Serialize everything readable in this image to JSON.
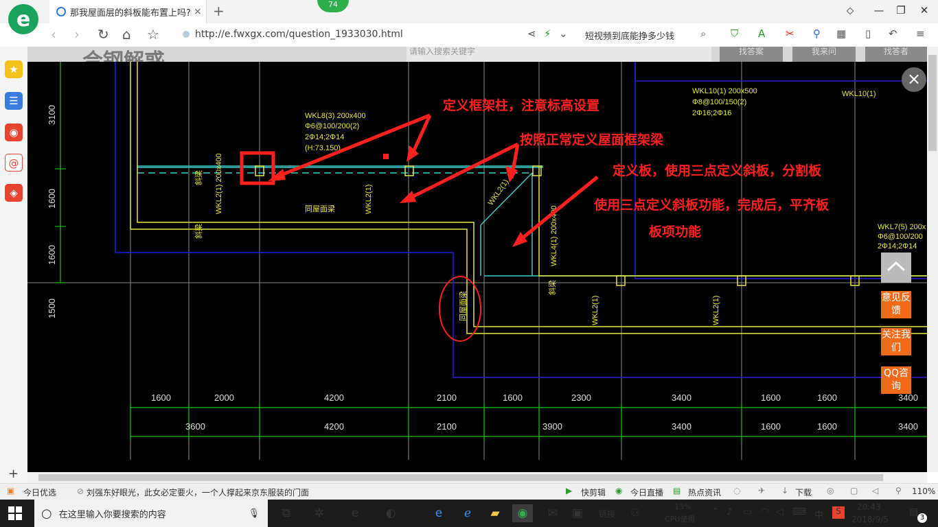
{
  "browser": {
    "tab_title": "那我屋面层的斜板能布置上吗? 7",
    "tab_close": "×",
    "new_tab": "+",
    "notif_badge": "74",
    "url": "http://e.fwxgx.com/question_1933030.html",
    "search_query": "短视频到底能挣多少钱",
    "window_controls": [
      "⬦",
      "—",
      "❐",
      "✕"
    ]
  },
  "page_overlay": {
    "close_label": "×",
    "feedback_label": "意见反馈",
    "follow_label": "关注我们",
    "qq_label": "QQ咨询",
    "bg_text": "合钢解惑",
    "bg_search_placeholder": "请输入搜索关键字",
    "bg_buttons": [
      "找答案",
      "我来问",
      "找答者"
    ]
  },
  "cad_drawing": {
    "annotations": [
      "定义框架柱，注意标高设置",
      "按照正常定义屋面框架梁",
      "定义板，使用三点定义斜板，分割板",
      "使用三点定义斜板功能，完成后，平齐板",
      "板项功能"
    ],
    "beam_labels": {
      "wkl8": [
        "WKL8(3) 200x400",
        "Φ6@100/200(2)",
        "2Φ14;2Φ14",
        "(H:73.150)"
      ],
      "wkl10a": [
        "WKL10(1) 200x500",
        "Φ8@100/150(2)",
        "2Φ16;2Φ16"
      ],
      "wkl10b": "WKL10(1)",
      "wkl7": [
        "WKL7(5) 200x",
        "Φ6@100/200",
        "2Φ14;2Φ14"
      ],
      "wkl2_vertical": [
        "WKL2(1)",
        "WKL2(1)",
        "WKL2(1)",
        "WKL2(1)"
      ],
      "wkl4": "WKL4(1) 200x400",
      "wkl2_stirrup": "WKL2(1) 200x400",
      "misc": [
        "同屋面梁",
        "同屋面梁",
        "斜梁",
        "斜梁",
        "斜梁"
      ]
    },
    "dim_left": [
      "3100",
      "1600",
      "1600",
      "1500"
    ],
    "dim_row1": [
      "1600",
      "2000",
      "4200",
      "2100",
      "1600",
      "2300",
      "3400",
      "1600",
      "1600",
      "3400"
    ],
    "dim_row2": [
      "3600",
      "4200",
      "2100",
      "3900",
      "3400",
      "1600",
      "1600",
      "3400"
    ]
  },
  "status_strip": {
    "today": "今日优选",
    "news": "刘强东好眼光，此女必定要火，一个人撑起来京东服装的门面",
    "items": [
      "快剪辑",
      "今日直播",
      "热点资讯",
      "下载"
    ],
    "zoom": "110%"
  },
  "taskbar": {
    "search_placeholder": "在这里输入你要搜索的内容",
    "link_label": "链接",
    "cpu_value": "13%",
    "cpu_label": "CPU使用",
    "ime": "中",
    "time": "20:43",
    "date": "2018/9/5",
    "notif_count": "3"
  },
  "colors": {
    "annotation_red": "#ff2020",
    "cad_yellow": "#e8e83a",
    "cad_cyan": "#3fc8c8",
    "cad_blue": "#2020d8",
    "cad_green": "#20c020",
    "side_orange": "#f06a1a"
  }
}
